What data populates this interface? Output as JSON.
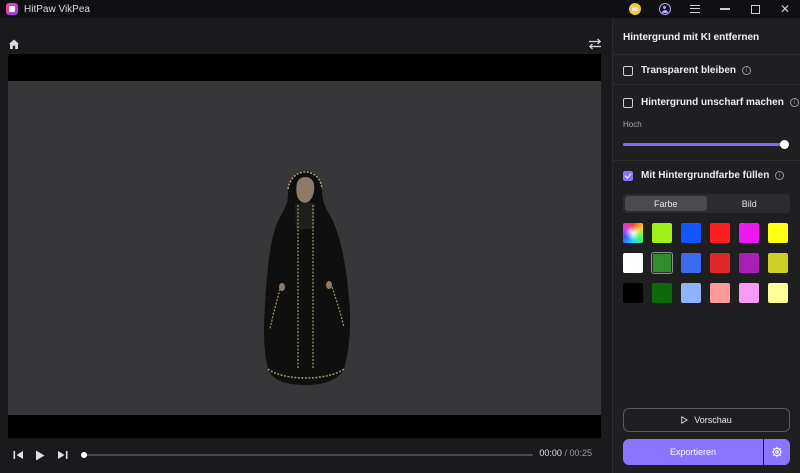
{
  "window": {
    "title": "HitPaw VikPea"
  },
  "player": {
    "current_time": "00:00",
    "separator": "/",
    "duration": "00:25"
  },
  "panel": {
    "title": "Hintergrund mit KI entfernen",
    "option_transparent": "Transparent bleiben",
    "option_blur": "Hintergrund unscharf machen",
    "slider_label": "Hoch",
    "slider_value": 1.0,
    "option_fill": "Mit Hintergrundfarbe füllen",
    "tab_color": "Farbe",
    "tab_image": "Bild",
    "swatches": [
      "gradient",
      "#9ef01a",
      "#1156ff",
      "#ff1e1e",
      "#ee19f0",
      "#ffff14",
      "#ffffff",
      "#2f8f2f",
      "#3a6cf0",
      "#e02828",
      "#a71fb6",
      "#cfcf28",
      "#000000",
      "#0b6b0b",
      "#8fb3ff",
      "#ff9a9a",
      "#f59af5",
      "#ffff99"
    ],
    "selected_swatch": 7,
    "preview_label": "Vorschau",
    "export_label": "Exportieren"
  },
  "colors": {
    "accent": "#8b74ff"
  }
}
